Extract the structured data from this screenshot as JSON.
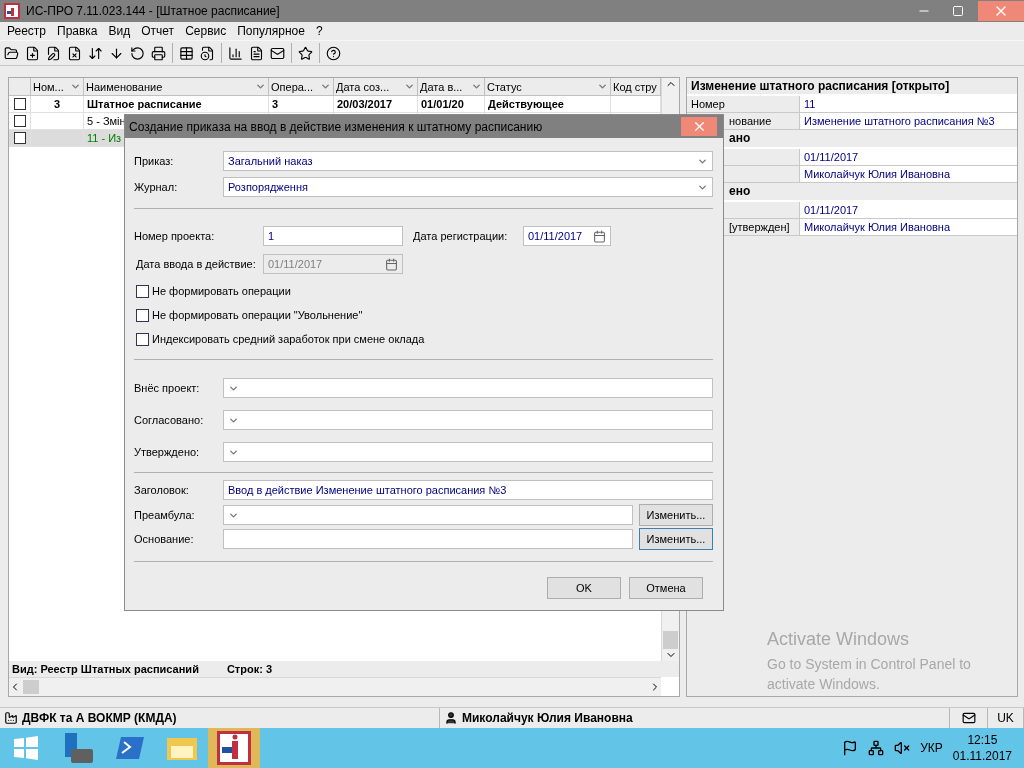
{
  "window": {
    "title": "ИС-ПРО 7.11.023.144 - [Штатное расписание]"
  },
  "menu": [
    "Реестр",
    "Правка",
    "Вид",
    "Отчет",
    "Сервис",
    "Популярное",
    "?"
  ],
  "table": {
    "columns": [
      "Ном...",
      "Наименование",
      "Опера...",
      "Дата соз...",
      "Дата в...",
      "Статус",
      "Код стру"
    ],
    "rows": [
      {
        "kind": "group",
        "checked": false,
        "selected": false,
        "cells": [
          "3",
          "Штатное расписание",
          "3",
          "20/03/2017",
          "01/01/20",
          "Действующее",
          ""
        ]
      },
      {
        "kind": "item",
        "checked": false,
        "selected": false,
        "cells": [
          "",
          "5 - Змін"
        ]
      },
      {
        "kind": "current",
        "checked": false,
        "selected": true,
        "cells": [
          "",
          "11 - Из"
        ]
      }
    ]
  },
  "table_footer": {
    "view": "Вид: Реестр Штатных расписаний",
    "count": "Строк: 3"
  },
  "details": {
    "title": "Изменение штатного расписания [открыто]",
    "rows": [
      {
        "kind": "field",
        "label": "Номер",
        "value": "11"
      },
      {
        "kind": "field",
        "label": "нование",
        "partial": true,
        "value": "Изменение штатного расписания №3"
      },
      {
        "kind": "section",
        "label": "ано",
        "partial": true
      },
      {
        "kind": "field",
        "value": "01/11/2017"
      },
      {
        "kind": "field",
        "value": "Миколайчук Юлия Ивановна"
      },
      {
        "kind": "section",
        "label": "ено",
        "partial": true
      },
      {
        "kind": "field",
        "value": "01/11/2017"
      },
      {
        "kind": "field",
        "label": "[утвержден]",
        "partial": true,
        "value": "Миколайчук Юлия Ивановна"
      }
    ]
  },
  "activation": {
    "title": "Activate Windows",
    "text": "Go to System in Control Panel to activate Windows."
  },
  "dialog": {
    "title": "Создание приказа на ввод в действие изменения к штатному расписанию",
    "top_fields": [
      {
        "label": "Приказ:",
        "value": "Загальний наказ"
      },
      {
        "label": "Журнал:",
        "value": "Розпорядження"
      }
    ],
    "project_number": {
      "label": "Номер проекта:",
      "value": "1"
    },
    "registration_date": {
      "label": "Дата регистрации:",
      "value": "01/11/2017",
      "disabled": false
    },
    "effective_date": {
      "label": "Дата ввода в действие:",
      "value": "01/11/2017",
      "disabled": true
    },
    "options": [
      {
        "label": "Не формировать операции",
        "checked": false
      },
      {
        "label": "Не формировать операции \"Увольнение\"",
        "checked": false
      },
      {
        "label": "Индексировать средний заработок при смене оклада",
        "checked": false
      }
    ],
    "signers": [
      {
        "label": "Внёс проект:"
      },
      {
        "label": "Согласовано:"
      },
      {
        "label": "Утверждено:"
      }
    ],
    "heading": {
      "label": "Заголовок:",
      "value": "Ввод в действие Изменение штатного расписания №3"
    },
    "preamble": {
      "label": "Преамбула:",
      "button": "Изменить...",
      "focused": false
    },
    "basis": {
      "label": "Основание:",
      "button": "Изменить...",
      "focused": true
    },
    "buttons": [
      "OK",
      "Отмена"
    ]
  },
  "status_bar": {
    "organization": "ДВФК та А ВОКМР (КМДА)",
    "user": "Миколайчук Юлия Ивановна",
    "language": "UK"
  },
  "taskbar": {
    "language": "УКР",
    "time": "12:15",
    "date": "01.11.2017"
  }
}
